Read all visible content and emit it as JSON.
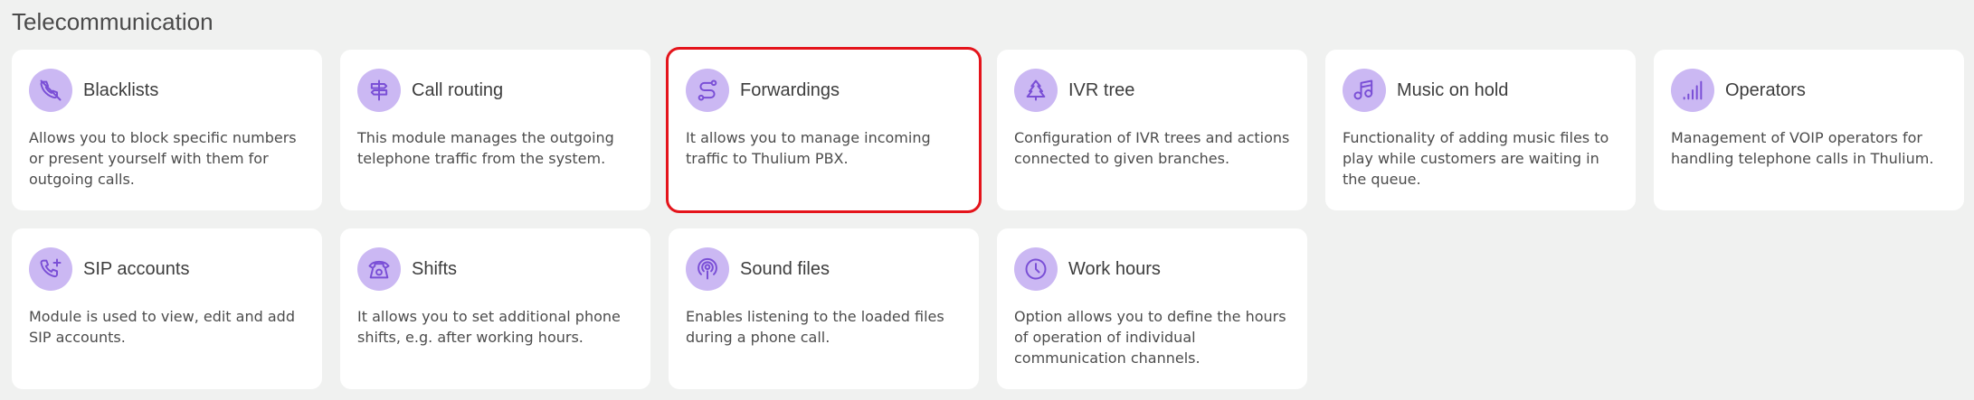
{
  "section": {
    "title": "Telecommunication"
  },
  "selected_index": 2,
  "colors": {
    "icon_bg": "#cbb8f3",
    "icon_stroke": "#7a4fd6",
    "selection": "#e4141b",
    "page_bg": "#f0f1f0"
  },
  "cards": [
    {
      "title": "Blacklists",
      "description": "Allows you to block specific numbers or present yourself with them for outgoing calls.",
      "icon": "phone-blocked-icon"
    },
    {
      "title": "Call routing",
      "description": "This module manages the outgoing telephone traffic from the system.",
      "icon": "signpost-icon"
    },
    {
      "title": "Forwardings",
      "description": "It allows you to manage incoming traffic to Thulium PBX.",
      "icon": "route-icon"
    },
    {
      "title": "IVR tree",
      "description": "Configuration of IVR trees and actions connected to given branches.",
      "icon": "tree-icon"
    },
    {
      "title": "Music on hold",
      "description": "Functionality of adding music files to play while customers are waiting in the queue.",
      "icon": "music-note-icon"
    },
    {
      "title": "Operators",
      "description": "Management of VOIP operators for handling telephone calls in Thulium.",
      "icon": "signal-bars-icon"
    },
    {
      "title": "SIP accounts",
      "description": "Module is used to view, edit and add SIP accounts.",
      "icon": "phone-plus-icon"
    },
    {
      "title": "Shifts",
      "description": "It allows you to set additional phone shifts, e.g. after working hours.",
      "icon": "rotary-phone-icon"
    },
    {
      "title": "Sound files",
      "description": "Enables listening to the loaded files during a phone call.",
      "icon": "podcast-icon"
    },
    {
      "title": "Work hours",
      "description": "Option allows you to define the hours of operation of individual communication channels.",
      "icon": "clock-icon"
    }
  ]
}
